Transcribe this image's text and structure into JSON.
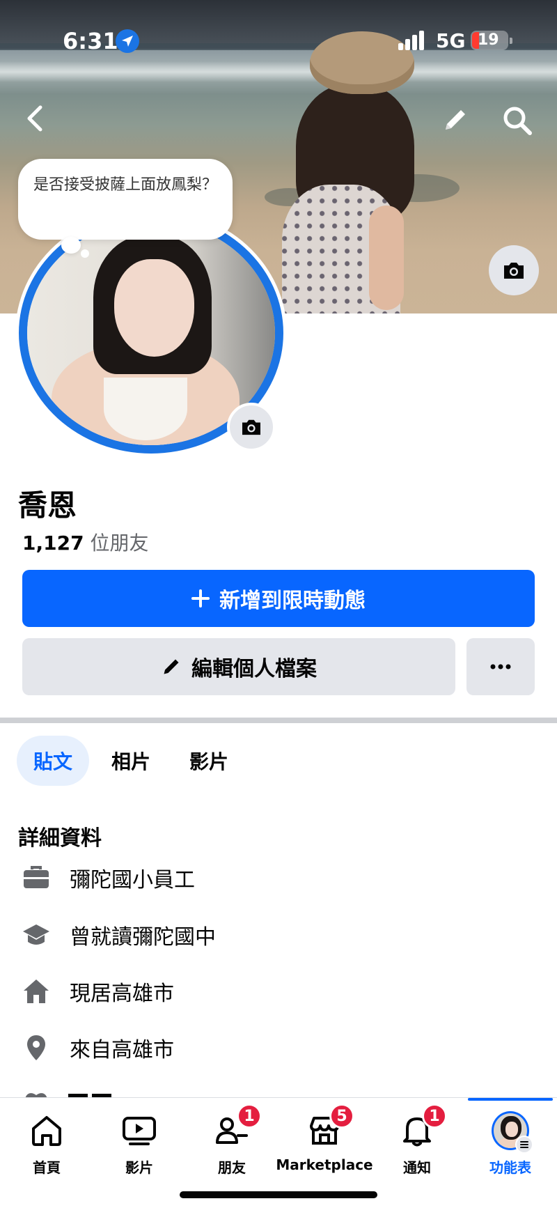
{
  "status_bar": {
    "time": "6:31",
    "network": "5G",
    "battery_level": "19",
    "icons": [
      "location-arrow-icon",
      "signal-icon",
      "battery-icon"
    ]
  },
  "cover": {
    "icons": [
      "back-icon",
      "pencil-icon",
      "search-icon",
      "camera-icon"
    ]
  },
  "note": {
    "text": "是否接受披薩上面放鳳梨？"
  },
  "profile": {
    "name": "喬恩",
    "friends_count": "1,127",
    "friends_label": "位朋友"
  },
  "actions": {
    "add_story": "新增到限時動態",
    "edit_profile": "編輯個人檔案",
    "more": "···"
  },
  "tabs": [
    {
      "label": "貼文",
      "active": true
    },
    {
      "label": "相片",
      "active": false
    },
    {
      "label": "影片",
      "active": false
    }
  ],
  "details": {
    "title": "詳細資料",
    "items": [
      {
        "icon": "briefcase-icon",
        "text": "彌陀國小員工"
      },
      {
        "icon": "graduation-cap-icon",
        "text": "曾就讀彌陀國中"
      },
      {
        "icon": "house-icon",
        "text": "現居高雄市"
      },
      {
        "icon": "location-pin-icon",
        "text": "來自高雄市"
      }
    ]
  },
  "bottom_nav": [
    {
      "label": "首頁",
      "icon": "home-icon",
      "badge": ""
    },
    {
      "label": "影片",
      "icon": "video-icon",
      "badge": ""
    },
    {
      "label": "朋友",
      "icon": "friends-icon",
      "badge": "1"
    },
    {
      "label": "Marketplace",
      "icon": "marketplace-icon",
      "badge": "5"
    },
    {
      "label": "通知",
      "icon": "bell-icon",
      "badge": "1"
    },
    {
      "label": "功能表",
      "icon": "menu-avatar-icon",
      "badge": "",
      "active": true
    }
  ],
  "colors": {
    "accent": "#0866ff",
    "badge": "#e41e3f",
    "secondary_button": "#e4e6eb",
    "tab_active_bg": "#e7f0fd"
  }
}
